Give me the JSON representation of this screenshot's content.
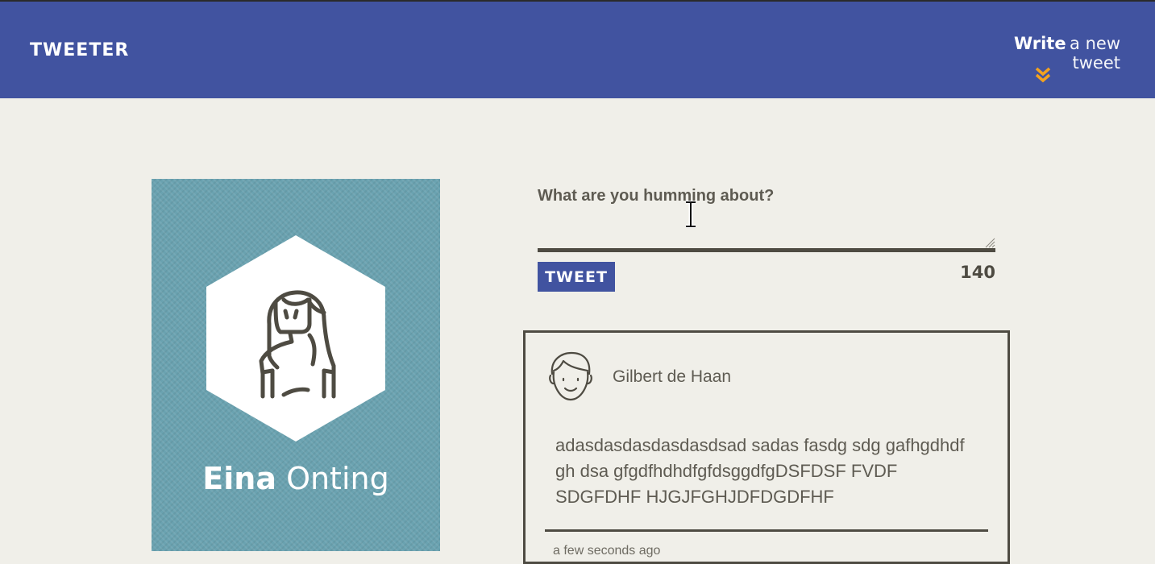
{
  "header": {
    "brand": "TWEETER",
    "compose_toggle_bold": "Write",
    "compose_toggle_rest": "a new tweet"
  },
  "profile": {
    "first_name": "Eina",
    "last_name": "Onting"
  },
  "compose": {
    "label": "What are you humming about?",
    "value": "",
    "button_label": "TWEET",
    "counter": "140"
  },
  "tweets": [
    {
      "author": "Gilbert de Haan",
      "body": "adasdasdasdasdasdsad sadas fasdg sdg gafhgdhdf gh dsa gfgdfhdhdfgfdsggdfgDSFDSF FVDF SDGFDHF HJGJFGHJDFDGDFHF",
      "time": "a few seconds ago"
    }
  ],
  "colors": {
    "header_bg": "#4153a0",
    "accent": "#f3a21f",
    "page_bg": "#f0efe9",
    "profile_bg": "#6aa2b0",
    "ink": "#4e4b42"
  },
  "icons": {
    "compose_toggle": "double-chevron-down-icon",
    "profile_avatar": "woman-avatar-icon",
    "tweet_avatar": "man-avatar-icon",
    "cursor": "text-cursor-icon"
  }
}
